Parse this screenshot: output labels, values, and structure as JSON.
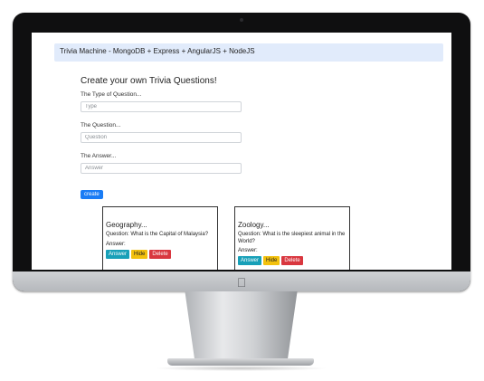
{
  "navbar": {
    "title": "Trivia Machine - MongoDB + Express + AngularJS + NodeJS"
  },
  "form": {
    "heading": "Create your own Trivia Questions!",
    "type_label": "The Type of Question...",
    "type_placeholder": "Type",
    "question_label": "The Question...",
    "question_placeholder": "Question",
    "answer_label": "The Answer...",
    "answer_placeholder": "Answer",
    "create_label": "create"
  },
  "cards": [
    {
      "title": "Geography...",
      "question": "Question: What is the Capital of Malaysia?",
      "answer_label": "Answer:",
      "buttons": {
        "answer": "Answer",
        "hide": "Hide",
        "delete": "Delete"
      }
    },
    {
      "title": "Zoology...",
      "question": "Question: What is the sleepiest animal in the World?",
      "answer_label": "Answer:",
      "buttons": {
        "answer": "Answer",
        "hide": "Hide",
        "delete": "Delete"
      }
    }
  ],
  "colors": {
    "primary": "#1a7cf5",
    "info": "#18a0b8",
    "warning": "#f3c10d",
    "danger": "#d9373f",
    "navbar_bg": "#e1ebfb"
  },
  "icons": {
    "monitor_logo": "apple-icon"
  }
}
